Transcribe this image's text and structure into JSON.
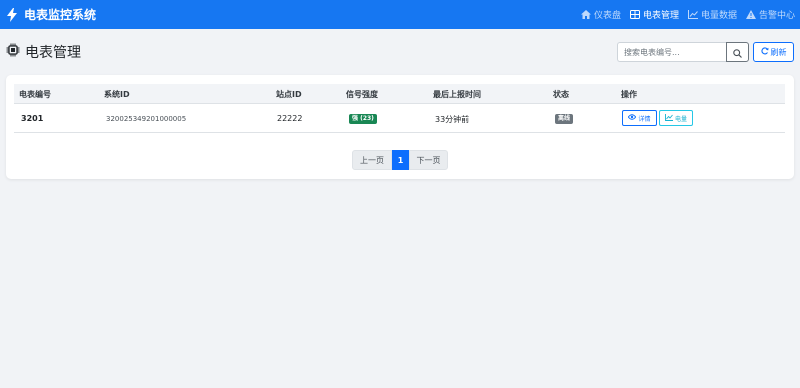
{
  "app": {
    "title": "电表监控系统"
  },
  "nav": {
    "items": [
      {
        "label": "仪表盘",
        "icon": "home-icon",
        "active": false
      },
      {
        "label": "电表管理",
        "icon": "table-icon",
        "active": true
      },
      {
        "label": "电量数据",
        "icon": "chart-line-icon",
        "active": false
      },
      {
        "label": "告警中心",
        "icon": "warning-icon",
        "active": false
      }
    ]
  },
  "page": {
    "title": "电表管理",
    "title_icon": "meter-chip-icon",
    "search_placeholder": "搜索电表编号...",
    "refresh_label": "刷新"
  },
  "table": {
    "columns": [
      "电表编号",
      "系统ID",
      "站点ID",
      "信号强度",
      "最后上报时间",
      "状态",
      "操作"
    ],
    "rows": [
      {
        "meter_no": "3201",
        "system_id": "320025349201000005",
        "station_id": "22222",
        "signal": "强 (23)",
        "last_report": "33分钟前",
        "status": "离线",
        "actions": {
          "detail": "详情",
          "power": "电量"
        }
      }
    ]
  },
  "pagination": {
    "prev": "上一页",
    "current": "1",
    "next": "下一页"
  },
  "colors": {
    "navbar": "#1677f2",
    "primary": "#0d6efd",
    "signal_strong": "#198754",
    "status_offline": "#6c757d",
    "info": "#17b2d0"
  }
}
